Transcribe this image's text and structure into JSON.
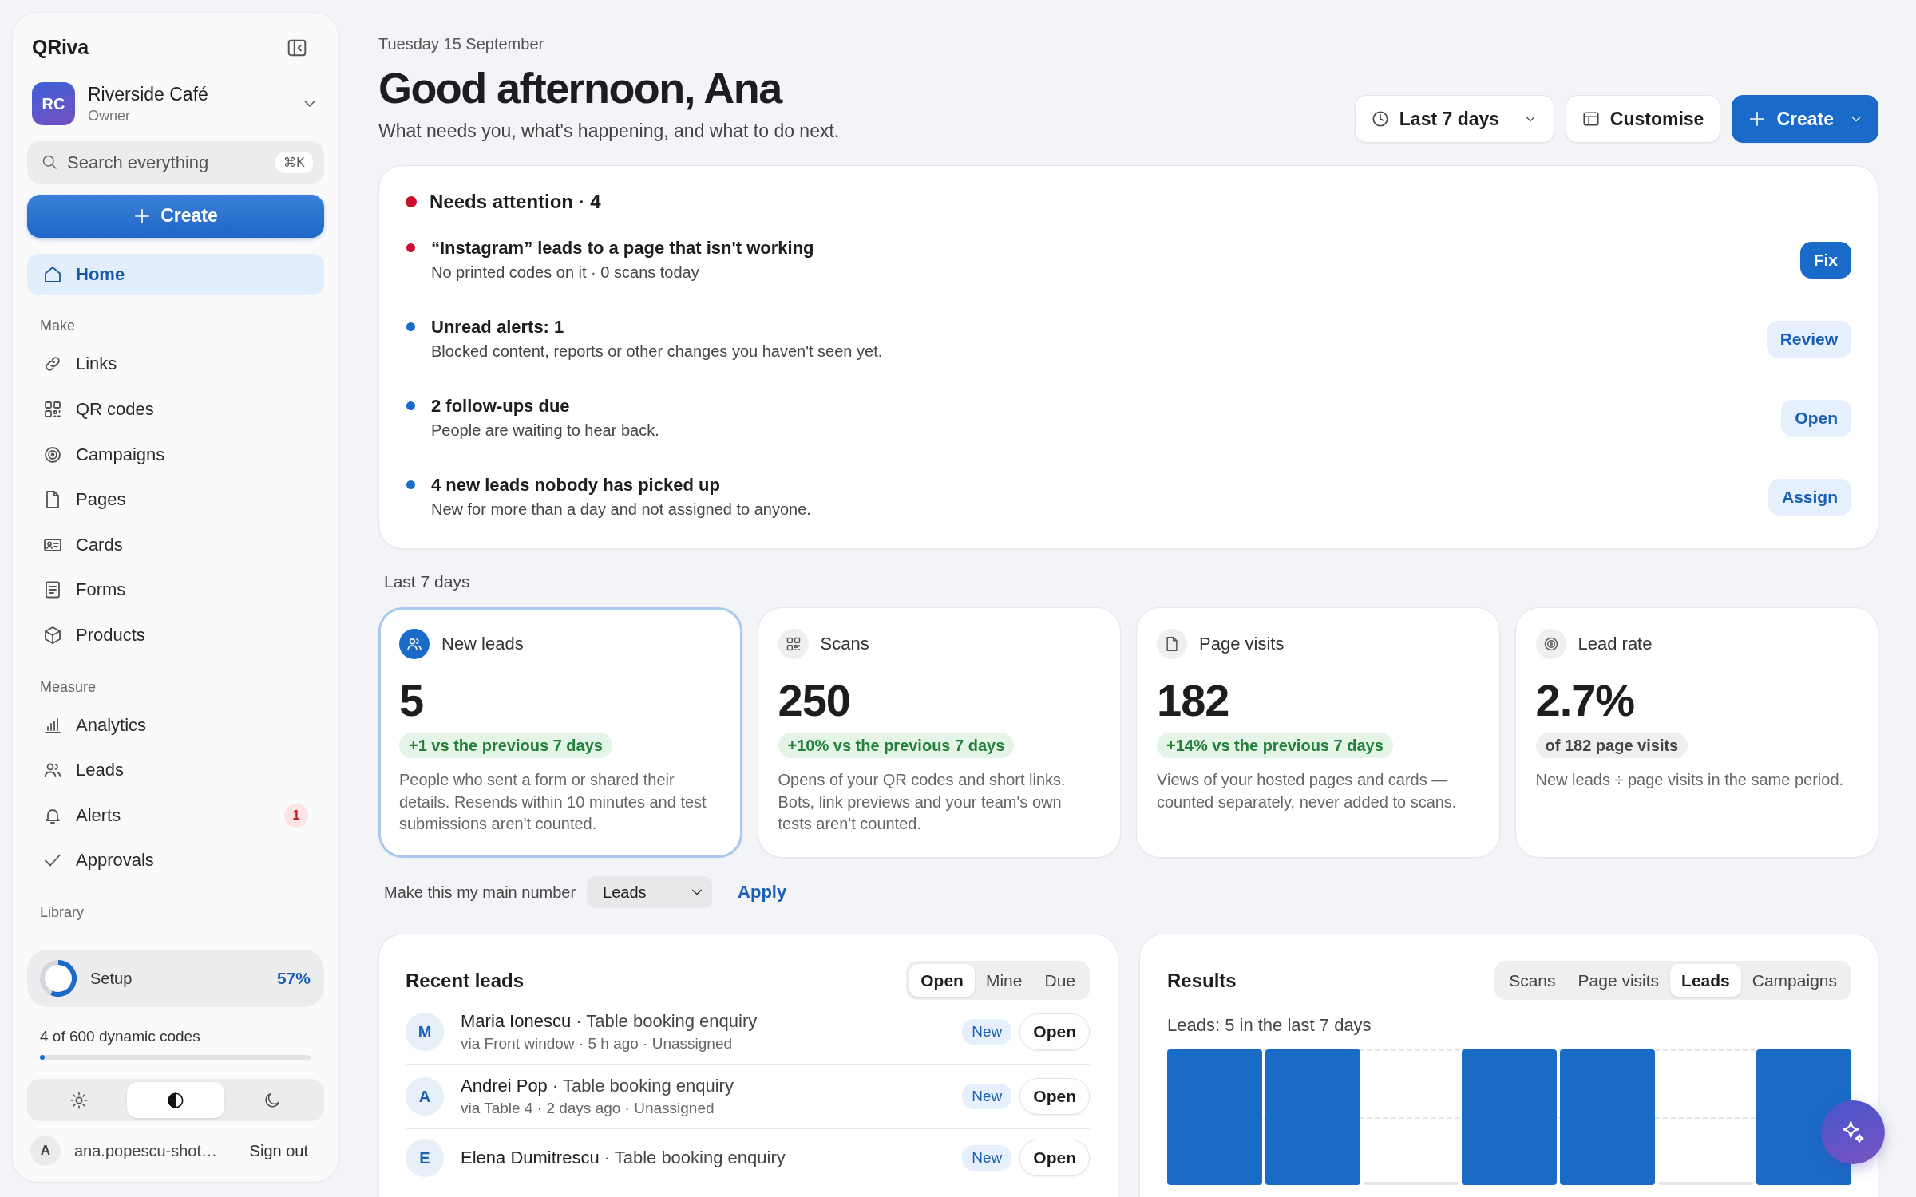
{
  "sidebar": {
    "brand": "QRiva",
    "account": {
      "initials": "RC",
      "name": "Riverside Café",
      "role": "Owner"
    },
    "search": {
      "placeholder": "Search everything",
      "shortcut": "⌘K"
    },
    "create": "Create",
    "home": {
      "label": "Home",
      "selected": true
    },
    "sections": [
      {
        "title": "Make",
        "items": [
          {
            "label": "Links",
            "selected": false
          },
          {
            "label": "QR codes",
            "selected": false
          },
          {
            "label": "Campaigns",
            "selected": false
          },
          {
            "label": "Pages",
            "selected": false
          },
          {
            "label": "Cards",
            "selected": false
          },
          {
            "label": "Forms",
            "selected": false
          },
          {
            "label": "Products",
            "selected": false
          }
        ]
      },
      {
        "title": "Measure",
        "items": [
          {
            "label": "Analytics",
            "selected": false
          },
          {
            "label": "Leads",
            "selected": false
          },
          {
            "label": "Alerts",
            "selected": false,
            "badge": "1"
          },
          {
            "label": "Approvals",
            "selected": false
          }
        ]
      },
      {
        "title": "Library"
      }
    ],
    "setup": {
      "label": "Setup",
      "level": 0.57,
      "percent": "57%"
    },
    "usage": {
      "label": "4 of 600 dynamic codes",
      "level": 0.0067
    },
    "theme_modes": [
      {
        "selected": false
      },
      {
        "selected": true
      },
      {
        "selected": false
      }
    ],
    "user": {
      "initial": "A",
      "email": "ana.popescu-shot…",
      "sign_out": "Sign out"
    }
  },
  "header": {
    "date": "Tuesday 15 September",
    "greeting": "Good afternoon, Ana",
    "subtitle": "What needs you, what's happening, and what to do next.",
    "buttons": [
      {
        "label": "Last 7 days",
        "kind": "dropdown"
      },
      {
        "label": "Customise",
        "kind": "plain"
      },
      {
        "label": "Create",
        "kind": "primary"
      }
    ]
  },
  "attention": {
    "title": "Needs attention · 4",
    "color": "#c8102e",
    "items": [
      {
        "title": "“Instagram” leads to a page that isn't working",
        "detail": "No printed codes on it · 0 scans today",
        "action": "Fix",
        "kind": "primary",
        "color": "#c8102e"
      },
      {
        "title": "Unread alerts: 1",
        "detail": "Blocked content, reports or other changes you haven't seen yet.",
        "action": "Review",
        "kind": "soft",
        "color": "#1a6ac9"
      },
      {
        "title": "2 follow-ups due",
        "detail": "People are waiting to hear back.",
        "action": "Open",
        "kind": "soft",
        "color": "#1a6ac9"
      },
      {
        "title": "4 new leads nobody has picked up",
        "detail": "New for more than a day and not assigned to anyone.",
        "action": "Assign",
        "kind": "soft",
        "color": "#1a6ac9"
      }
    ]
  },
  "period_label": "Last 7 days",
  "stats": [
    {
      "label": "New leads",
      "value": "5",
      "change": "+1 vs the previous 7 days",
      "kind": "positive",
      "description": "People who sent a form or shared their details. Resends within 10 minutes and test submissions aren't counted.",
      "selected": true
    },
    {
      "label": "Scans",
      "value": "250",
      "change": "+10% vs the previous 7 days",
      "kind": "positive",
      "description": "Opens of your QR codes and short links. Bots, link previews and your team's own tests aren't counted.",
      "selected": false
    },
    {
      "label": "Page visits",
      "value": "182",
      "change": "+14% vs the previous 7 days",
      "kind": "positive",
      "description": "Views of your hosted pages and cards — counted separately, never added to scans.",
      "selected": false
    },
    {
      "label": "Lead rate",
      "value": "2.7%",
      "change": "of 182 page visits",
      "kind": "neutral",
      "description": "New leads ÷ page visits in the same period.",
      "selected": false
    }
  ],
  "main_number": {
    "label": "Make this my main number",
    "value": "Leads",
    "apply": "Apply"
  },
  "recent_leads": {
    "title": "Recent leads",
    "filters": [
      {
        "label": "Open",
        "selected": true
      },
      {
        "label": "Mine",
        "selected": false
      },
      {
        "label": "Due",
        "selected": false
      }
    ],
    "rows": [
      {
        "initial": "M",
        "name": "Maria Ionescu",
        "detail": "· Table booking enquiry",
        "meta": "via Front window · 5 h ago · Unassigned",
        "badge": "New",
        "action": "Open"
      },
      {
        "initial": "A",
        "name": "Andrei Pop",
        "detail": "· Table booking enquiry",
        "meta": "via Table 4 · 2 days ago · Unassigned",
        "badge": "New",
        "action": "Open"
      },
      {
        "initial": "E",
        "name": "Elena Dumitrescu",
        "detail": "· Table booking enquiry",
        "badge": "New",
        "action": "Open"
      }
    ]
  },
  "results": {
    "title": "Results",
    "tabs": [
      {
        "label": "Scans",
        "selected": false
      },
      {
        "label": "Page visits",
        "selected": false
      },
      {
        "label": "Leads",
        "selected": true
      },
      {
        "label": "Campaigns",
        "selected": false
      }
    ],
    "caption": "Leads: 5 in the last 7 days"
  }
}
